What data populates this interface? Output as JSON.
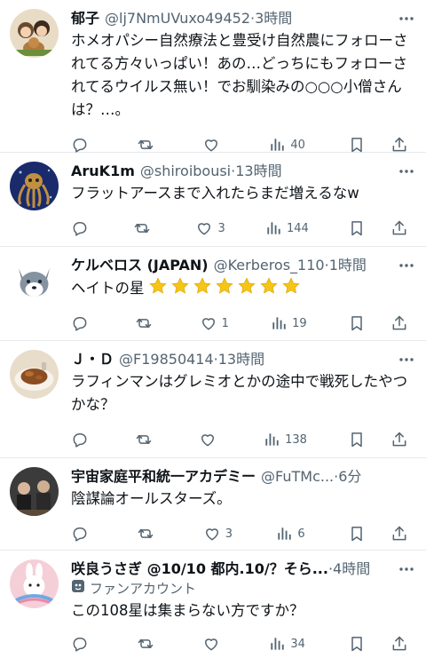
{
  "tweets": [
    {
      "display_name": "郁子",
      "handle": "@lj7NmUVuxo49452",
      "time": "3時間",
      "badge": "",
      "text": "ホメオパシー自然療法と豊受け自然農にフォローされてる方々いっぱい！あの…どっちにもフォローされてるウイルス無い！でお馴染みの○○○小僧さんは？…。",
      "replies": "",
      "retweets": "",
      "likes": "",
      "views": "40"
    },
    {
      "display_name": "AruK1m",
      "handle": "@shiroibousi",
      "time": "13時間",
      "badge": "",
      "text": "フラットアースまで入れたらまだ増えるなw",
      "replies": "",
      "retweets": "",
      "likes": "3",
      "views": "144"
    },
    {
      "display_name": "ケルベロス (JAPAN)",
      "handle": "@Kerberos_110",
      "time": "1時間",
      "badge": "",
      "text": "ヘイトの星",
      "star_count": 7,
      "replies": "",
      "retweets": "",
      "likes": "1",
      "views": "19"
    },
    {
      "display_name": "Ｊ・Ｄ",
      "handle": "@F19850414",
      "time": "13時間",
      "badge": "",
      "text": "ラフィンマンはグレミオとかの途中で戦死したやつかな？",
      "replies": "",
      "retweets": "",
      "likes": "",
      "views": "138"
    },
    {
      "display_name": "宇宙家庭平和統一アカデミー",
      "handle": "@FuTMc...",
      "time": "6分",
      "badge": "",
      "text": "陰謀論オールスターズ。",
      "replies": "",
      "retweets": "",
      "likes": "3",
      "views": "6"
    },
    {
      "display_name": "咲良うさぎ @10/10 都内.10/？そら...",
      "handle": "",
      "time": "4時間",
      "badge": "ファンアカウント",
      "text": "この108星は集まらない方ですか？",
      "replies": "",
      "retweets": "",
      "likes": "",
      "views": "34"
    }
  ],
  "separator": "·",
  "colors": {
    "text": "#0f1419",
    "secondary": "#536471",
    "divider": "#e6e9ec",
    "star": "#f5c518"
  },
  "icons": [
    "reply-icon",
    "retweet-icon",
    "like-icon",
    "views-icon",
    "bookmark-icon",
    "share-icon",
    "more-icon",
    "fan-account-icon",
    "star-icon"
  ]
}
